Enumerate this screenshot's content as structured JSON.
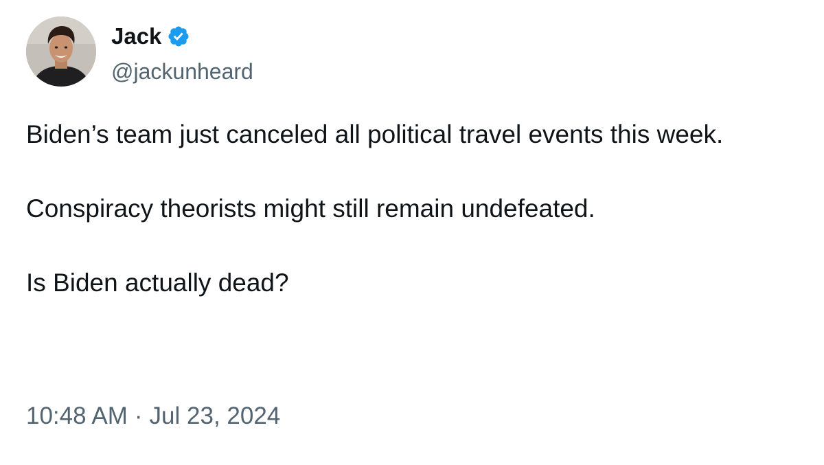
{
  "author": {
    "display_name": "Jack",
    "handle": "@jackunheard",
    "verified": true,
    "verified_icon": "verified-badge-icon",
    "verified_color": "#1d9bf0"
  },
  "tweet": {
    "paragraphs": [
      "Biden’s team just canceled all political travel events this week.",
      "Conspiracy theorists might still remain undefeated.",
      "Is Biden actually dead?"
    ]
  },
  "meta": {
    "time": "10:48 AM",
    "separator": "·",
    "date": "Jul 23, 2024"
  },
  "colors": {
    "text": "#0f1419",
    "secondary": "#536471",
    "background": "#ffffff"
  }
}
